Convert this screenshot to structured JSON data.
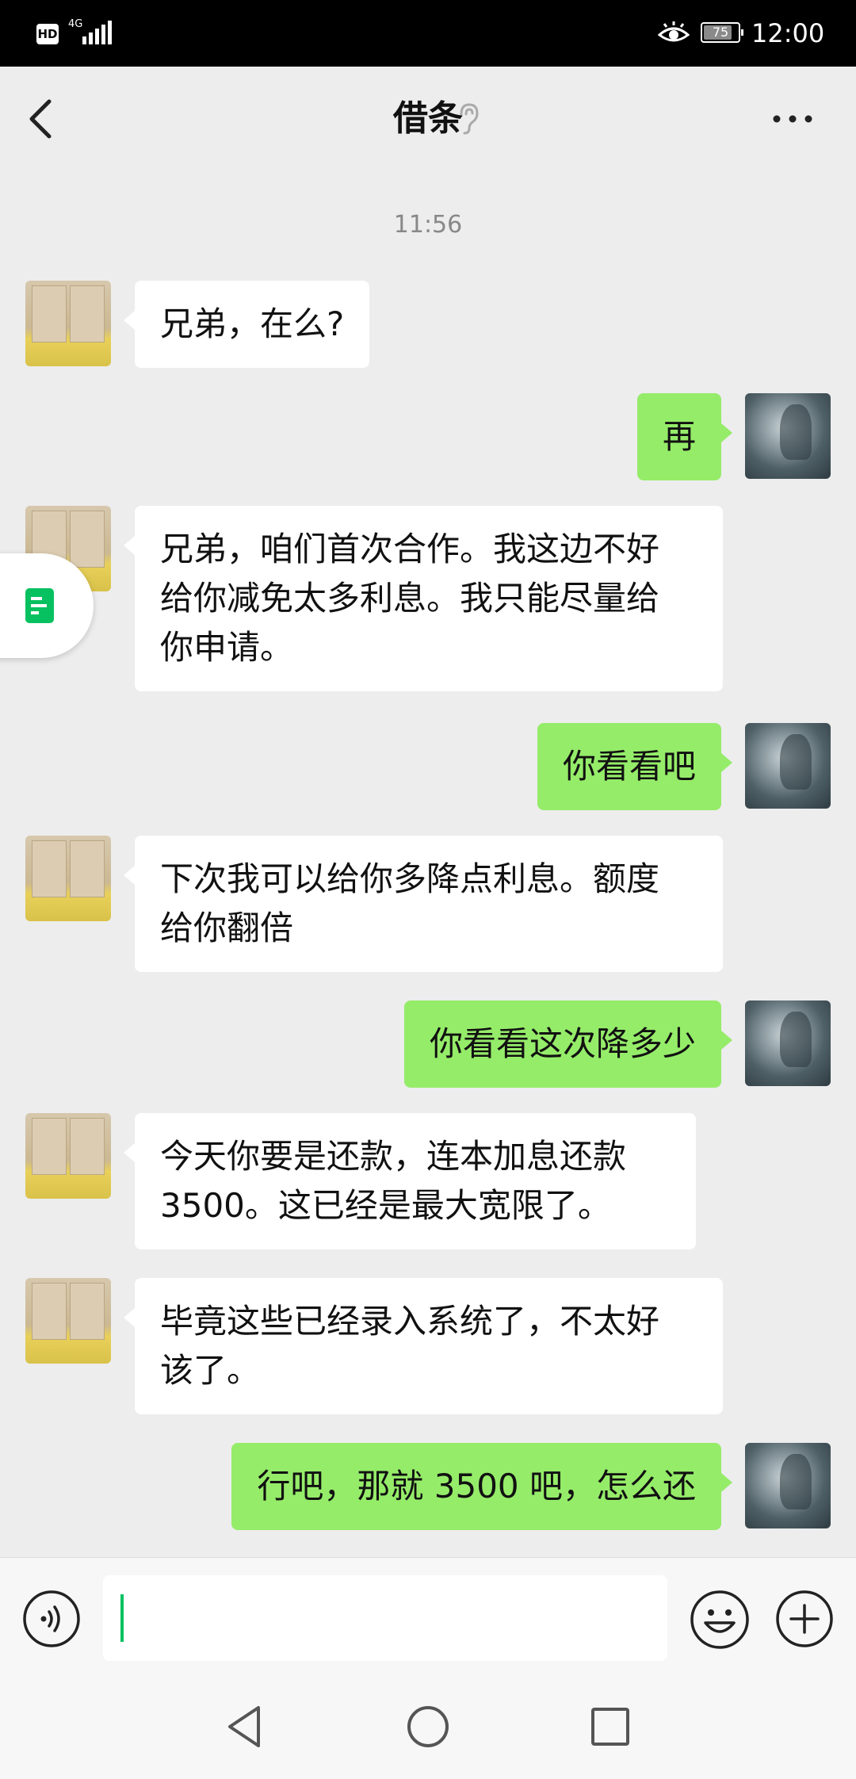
{
  "status_bar": {
    "hd_badge": "HD",
    "network": "4G",
    "battery": "75",
    "battery_level": 0.75,
    "time": "12:00"
  },
  "header": {
    "title": "借条",
    "back_icon": "chevron-left-icon",
    "ear_icon": "ear-icon",
    "more_icon": "more-dots-icon"
  },
  "chat": {
    "timestamp": "11:56",
    "messages": [
      {
        "side": "left",
        "text": "兄弟，在么?"
      },
      {
        "side": "right",
        "text": "再"
      },
      {
        "side": "left",
        "lines": [
          "兄弟，咱们首次合作。我这边不好",
          "给你减免太多利息。我只能尽量给",
          "你申请。"
        ]
      },
      {
        "side": "right",
        "text": "你看看吧"
      },
      {
        "side": "left",
        "lines": [
          "下次我可以给你多降点利息。额度",
          "给你翻倍"
        ]
      },
      {
        "side": "right",
        "text": "你看看这次降多少"
      },
      {
        "side": "left",
        "lines": [
          "今天你要是还款，连本加息还款",
          "3500。这已经是最大宽限了。"
        ]
      },
      {
        "side": "left",
        "lines": [
          "毕竟这些已经录入系统了，不太好",
          "该了。"
        ]
      },
      {
        "side": "right",
        "text": "行吧，那就 3500 吧，怎么还"
      }
    ]
  },
  "input_bar": {
    "value": "",
    "voice_icon": "voice-icon",
    "emoji_icon": "emoji-icon",
    "plus_icon": "plus-circle-icon"
  },
  "nav_bar": {
    "back_icon": "nav-back-icon",
    "home_icon": "nav-home-icon",
    "recents_icon": "nav-recents-icon"
  },
  "floating": {
    "icon": "note-icon"
  },
  "colors": {
    "bubble_right": "#95ec69",
    "bubble_left": "#ffffff",
    "background": "#ededed",
    "accent": "#07c160"
  }
}
